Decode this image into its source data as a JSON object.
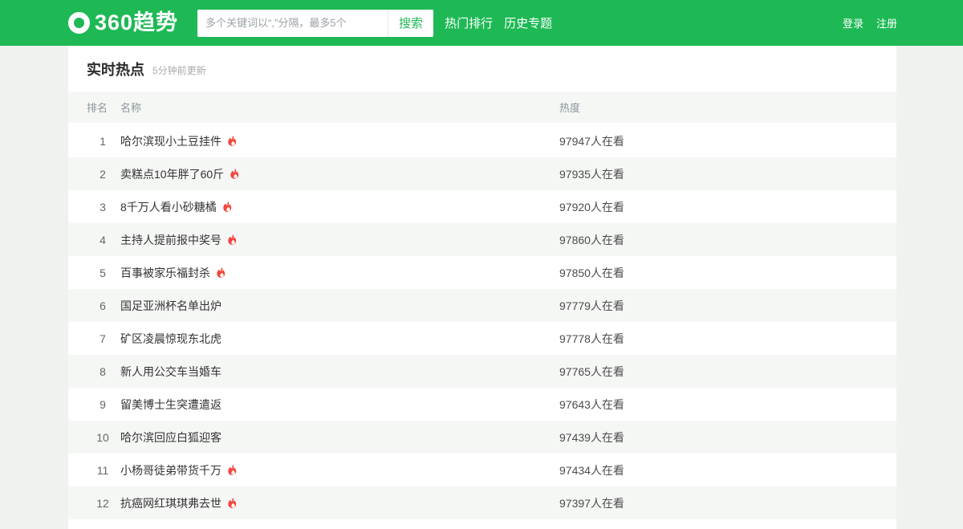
{
  "brand": {
    "logo_text": "360趋势"
  },
  "header": {
    "search_placeholder": "多个关键词以“,”分隔，最多5个",
    "search_button_label": "搜索",
    "nav_hot_label": "热门排行",
    "nav_history_label": "历史专题",
    "login_label": "登录",
    "register_label": "注册"
  },
  "page": {
    "title": "实时热点",
    "updated": "5分钟前更新"
  },
  "table": {
    "columns": {
      "rank": "排名",
      "name": "名称",
      "heat": "热度"
    },
    "rows": [
      {
        "rank": 1,
        "name": "哈尔滨现小土豆挂件",
        "hot": true,
        "heat": "97947人在看"
      },
      {
        "rank": 2,
        "name": "卖糕点10年胖了60斤",
        "hot": true,
        "heat": "97935人在看"
      },
      {
        "rank": 3,
        "name": "8千万人看小砂糖橘",
        "hot": true,
        "heat": "97920人在看"
      },
      {
        "rank": 4,
        "name": "主持人提前报中奖号",
        "hot": true,
        "heat": "97860人在看"
      },
      {
        "rank": 5,
        "name": "百事被家乐福封杀",
        "hot": true,
        "heat": "97850人在看"
      },
      {
        "rank": 6,
        "name": "国足亚洲杯名单出炉",
        "hot": false,
        "heat": "97779人在看"
      },
      {
        "rank": 7,
        "name": "矿区凌晨惊现东北虎",
        "hot": false,
        "heat": "97778人在看"
      },
      {
        "rank": 8,
        "name": "新人用公交车当婚车",
        "hot": false,
        "heat": "97765人在看"
      },
      {
        "rank": 9,
        "name": "留美博士生突遭遣返",
        "hot": false,
        "heat": "97643人在看"
      },
      {
        "rank": 10,
        "name": "哈尔滨回应白狐迎客",
        "hot": false,
        "heat": "97439人在看"
      },
      {
        "rank": 11,
        "name": "小杨哥徒弟带货千万",
        "hot": true,
        "heat": "97434人在看"
      },
      {
        "rank": 12,
        "name": "抗癌网红琪琪弗去世",
        "hot": true,
        "heat": "97397人在看"
      }
    ]
  },
  "colors": {
    "brand_green": "#1eb955",
    "fire_red": "#f4453c",
    "page_background": "#eff2ef",
    "stripe_row": "#f5f7f5"
  }
}
